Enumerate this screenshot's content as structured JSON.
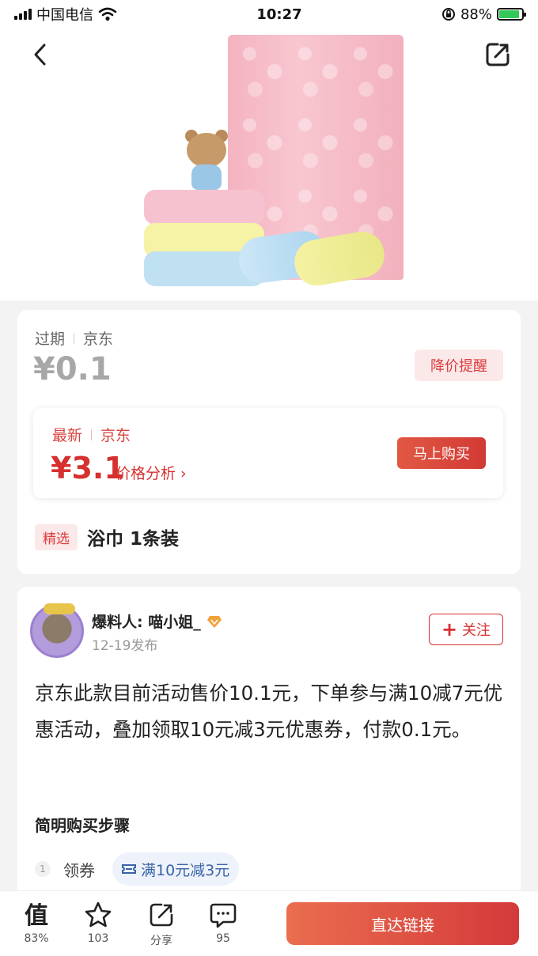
{
  "status_bar": {
    "carrier": "中国电信",
    "time": "10:27",
    "battery": "88%"
  },
  "product": {
    "expired_status": "过期",
    "expired_store": "京东",
    "old_price": "¥0.1",
    "price_alert_label": "降价提醒",
    "latest_status": "最新",
    "latest_store": "京东",
    "latest_price": "¥3.1",
    "price_analysis_label": "价格分析 ›",
    "buy_now_label": "马上购买",
    "tag": "精选",
    "title": "浴巾 1条装"
  },
  "author": {
    "name": "爆料人: 喵小姐_",
    "date": "12-19发布",
    "follow_label": "关注",
    "follow_plus": "+"
  },
  "content": {
    "body": "京东此款目前活动售价10.1元，下单参与满10减7元优惠活动，叠加领取10元减3元优惠券，付款0.1元。",
    "steps_title": "简明购买步骤",
    "steps": [
      {
        "num": "1",
        "label": "领券",
        "coupon": "满10元减3元"
      }
    ]
  },
  "bottom_bar": {
    "worth_rate": "83%",
    "favorites": "103",
    "share_label": "分享",
    "comments": "95",
    "go_label": "直达链接"
  },
  "colors": {
    "accent_red": "#d6302f",
    "tag_bg": "#fbe9ea",
    "coupon_blue": "#3a63a8"
  }
}
